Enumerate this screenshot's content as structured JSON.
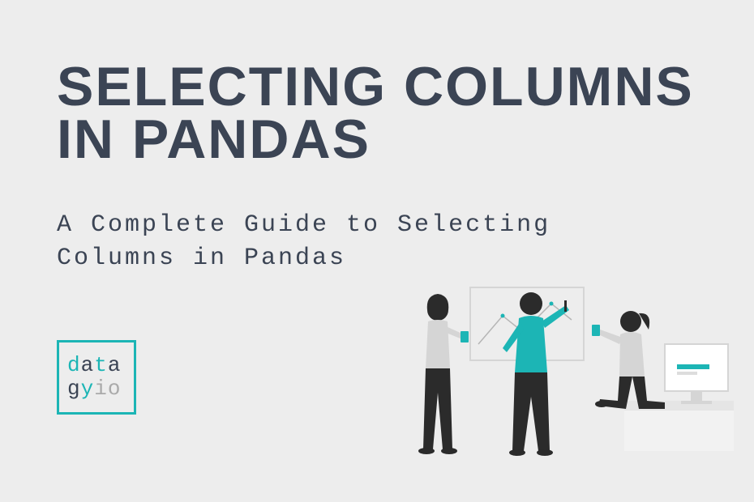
{
  "title": "SELECTING COLUMNS\nIN PANDAS",
  "subtitle": "A Complete Guide to Selecting Columns in Pandas",
  "logo": {
    "line1": [
      "d",
      "a",
      "t",
      "a"
    ],
    "line2": [
      "g",
      "y",
      "i",
      "o"
    ]
  },
  "colors": {
    "background": "#ededed",
    "text_dark": "#3b4454",
    "accent": "#1cb5b5",
    "muted": "#aaaaaa"
  }
}
